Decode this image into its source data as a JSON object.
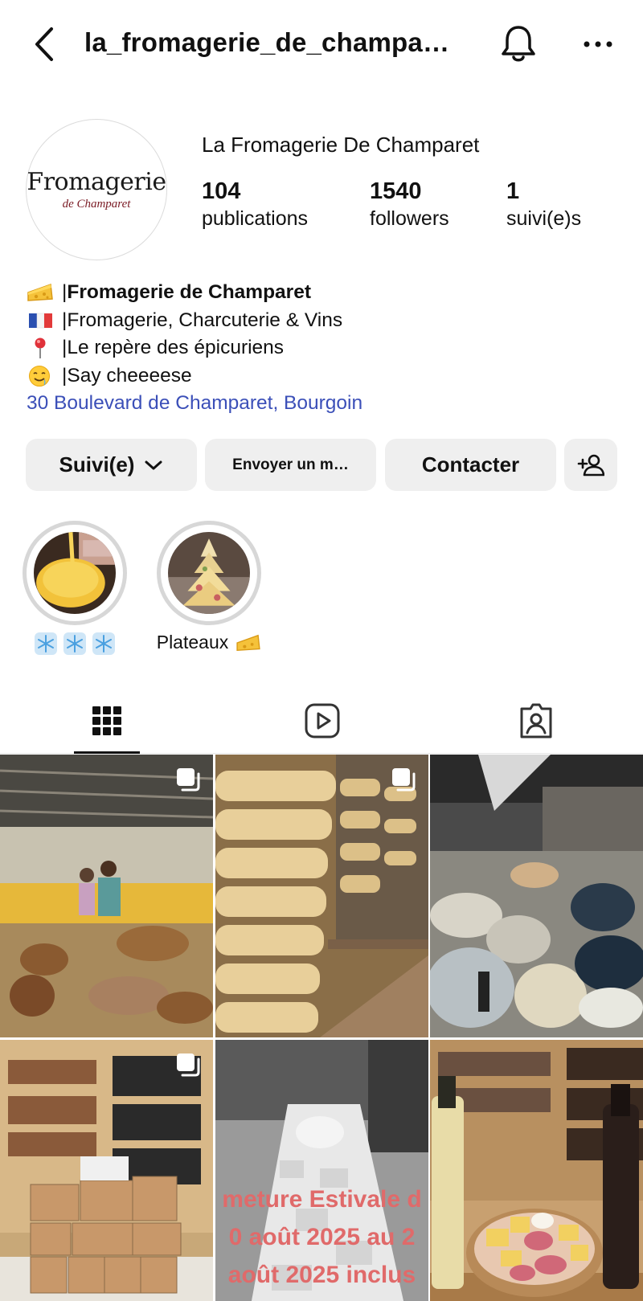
{
  "header": {
    "username": "la_fromagerie_de_champa…",
    "back_icon": "chevron-left-icon",
    "bell_icon": "bell-icon",
    "more_icon": "more-horizontal-icon"
  },
  "profile": {
    "avatar_text_main": "Fromagerie",
    "avatar_text_sub": "de Champaret",
    "display_name": "La Fromagerie De Champaret",
    "stats": {
      "posts": {
        "value": "104",
        "label": "publications"
      },
      "followers": {
        "value": "1540",
        "label": "followers"
      },
      "following": {
        "value": "1",
        "label": "suivi(e)s"
      }
    }
  },
  "bio": {
    "lines": [
      {
        "emoji": "cheese-icon",
        "sep": "| ",
        "text": "Fromagerie de Champaret",
        "bold": true
      },
      {
        "emoji": "france-flag-icon",
        "sep": "| ",
        "text": "Fromagerie, Charcuterie & Vins",
        "bold": false
      },
      {
        "emoji": "pin-icon",
        "sep": "| ",
        "text": "Le repère des épicuriens",
        "bold": false
      },
      {
        "emoji": "drooling-face-icon",
        "sep": "| ",
        "text": "Say cheeeese",
        "bold": false
      }
    ],
    "address": "30 Boulevard de Champaret, Bourgoin"
  },
  "actions": {
    "follow_label": "Suivi(e)",
    "message_label": "Envoyer un m…",
    "contact_label": "Contacter",
    "add_user_icon": "add-user-icon"
  },
  "highlights": [
    {
      "label": "",
      "icon": "snowflake-icon"
    },
    {
      "label": "Plateaux",
      "icon": "cheese-icon"
    }
  ],
  "tabs": [
    {
      "name": "grid",
      "icon": "grid-icon",
      "active": true
    },
    {
      "name": "reels",
      "icon": "reels-icon",
      "active": false
    },
    {
      "name": "tagged",
      "icon": "tagged-icon",
      "active": false
    }
  ],
  "posts": [
    {
      "type": "photo",
      "multi": true
    },
    {
      "type": "photo",
      "multi": true
    },
    {
      "type": "photo",
      "multi": false
    },
    {
      "type": "photo",
      "multi": true
    },
    {
      "type": "photo",
      "multi": false,
      "overlay_lines": [
        "meture Estivale d",
        "0 août 2025 au 2",
        "août 2025 inclus"
      ]
    },
    {
      "type": "photo",
      "multi": false
    }
  ],
  "colors": {
    "link": "#3b4fb8",
    "button_bg": "#efefef",
    "overlay_text": "#e06a6a"
  }
}
